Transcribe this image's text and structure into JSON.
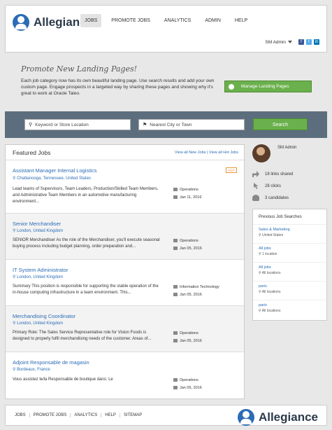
{
  "header": {
    "brand": "Allegiance",
    "nav": [
      "JOBS",
      "PROMOTE JOBS",
      "ANALYTICS",
      "ADMIN",
      "HELP"
    ],
    "user": "SM Admin"
  },
  "promo": {
    "title": "Promote New Landing Pages!",
    "text": "Each job category now has its own beautiful landing page. Use search results and add your own custom page. Engage prospects in a targeted way by sharing these pages and showing why it's great to work at Oracle Taleo.",
    "button": "Manage Landing Pages"
  },
  "search": {
    "keyword_placeholder": "Keyword or Store Location",
    "location_placeholder": "Nearest City or Town",
    "button": "Search"
  },
  "featured": {
    "title": "Featured Jobs",
    "link_new": "View all New Jobs",
    "link_hot": "View all Hot Jobs",
    "jobs": [
      {
        "title": "Assistant Manager Internal Logistics",
        "location": "Chattanooga, Tennessee, United States",
        "desc": "Lead teams of Supervisors, Team Leaders, Production/Skilled Team Members, and Administrative Team Members in an automotive manufacturing environment...",
        "category": "Operations",
        "date": "Jan 11, 2016",
        "badge": "HOT"
      },
      {
        "title": "Senior Merchandiser",
        "location": "London, United Kingdom",
        "desc": "SENIOR Merchandiser As the role of the Merchandiser, you'll execute seasonal buying process including budget planning, order preparation and...",
        "category": "Operations",
        "date": "Jan 05, 2016",
        "badge": ""
      },
      {
        "title": "IT System Administrator",
        "location": "London, United Kingdom",
        "desc": "Summary This position is responsible for supporting the stable operation of the in-house computing infrastructure in a team environment. This...",
        "category": "Information Technology",
        "date": "Jan 05, 2016",
        "badge": ""
      },
      {
        "title": "Merchandising Coordinator",
        "location": "London, United Kingdom",
        "desc": "Primary Role: The Sales Service Representative role for Vision Foods is designed to properly fulfil merchandising needs of the customer. Areas of...",
        "category": "Operations",
        "date": "Jan 05, 2016",
        "badge": ""
      },
      {
        "title": "Adjoint Responsable de magasin",
        "location": "Bordeaux, France",
        "desc": "Vous assistez le/la Responsable de boutique dans: Le",
        "category": "Operations",
        "date": "Jan 05, 2016",
        "badge": ""
      }
    ]
  },
  "profile": {
    "name": "SM Admin",
    "stats": [
      "18 links shared",
      "28 clicks",
      "3 candidates"
    ]
  },
  "previous": {
    "title": "Previous Job Searches",
    "items": [
      {
        "keyword": "Sales & Marketing",
        "location": "United States"
      },
      {
        "keyword": "All jobs",
        "location": "1 location"
      },
      {
        "keyword": "All jobs",
        "location": "All locations"
      },
      {
        "keyword": "paris",
        "location": "All locations"
      },
      {
        "keyword": "paris",
        "location": "All locations"
      }
    ]
  },
  "footer": {
    "links": [
      "JOBS",
      "PROMOTE JOBS",
      "ANALYTICS",
      "HELP",
      "SITEMAP"
    ],
    "brand": "Allegiance"
  },
  "colors": {
    "accent": "#2b6cb5",
    "green": "#6ab04c",
    "band": "#5c6e7d",
    "hot": "#e8963c"
  }
}
